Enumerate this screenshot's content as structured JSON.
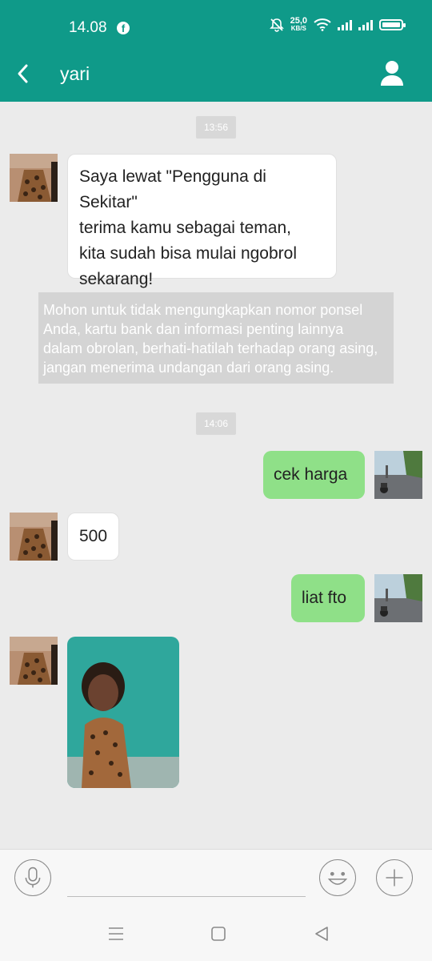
{
  "status_bar": {
    "time": "14.08",
    "net_speed": "25,0",
    "net_unit": "KB/S"
  },
  "header": {
    "title": "yari"
  },
  "chat": {
    "timestamp_1": "13:56",
    "greeting": [
      "Saya lewat \"Pengguna di Sekitar\"",
      "terima kamu sebagai teman,",
      "kita sudah bisa mulai ngobrol",
      "sekarang!"
    ],
    "notice": [
      "Mohon untuk tidak  mengungkapkan nomor ponsel",
      "Anda, kartu bank dan informasi penting lainnya",
      "dalam obrolan, berhati-hatilah terhadap orang asing,",
      "jangan menerima undangan dari orang asing."
    ],
    "timestamp_2": "14:06",
    "msg_out_1": "cek harga",
    "msg_in_1": "500",
    "msg_out_2": "liat fto"
  },
  "colors": {
    "accent": "#0f9a89",
    "outgoing_bubble": "#8fe088",
    "background": "#ebebeb"
  },
  "icons": [
    "facebook-icon",
    "mute-icon",
    "wifi-icon",
    "signal-icon",
    "battery-icon",
    "back-arrow-icon",
    "profile-icon",
    "microphone-icon",
    "emoji-icon",
    "plus-icon",
    "menu-icon",
    "home-icon",
    "back-icon"
  ]
}
